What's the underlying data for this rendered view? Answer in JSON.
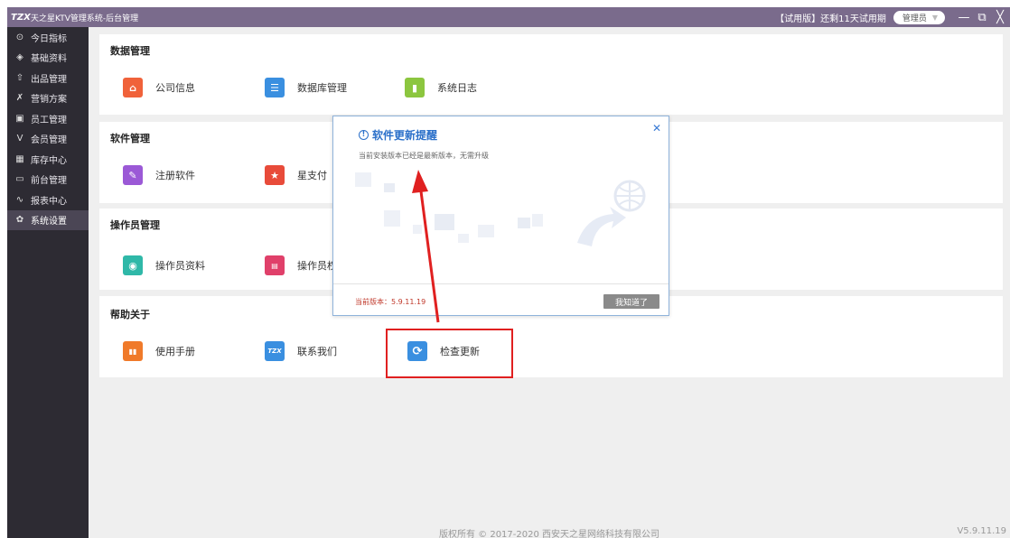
{
  "window": {
    "logo_text": "TZX",
    "title": "天之星KTV管理系统-后台管理",
    "trial_text": "【试用版】还剩11天试用期",
    "user_label": "管理员",
    "user_caret": "▼",
    "minimize": "—",
    "restore": "⧉",
    "close": "╳"
  },
  "sidebar": {
    "items": [
      {
        "label": "今日指标",
        "icon": "target-icon",
        "glyph": "⊙"
      },
      {
        "label": "基础资料",
        "icon": "layers-icon",
        "glyph": "◈"
      },
      {
        "label": "出品管理",
        "icon": "upload-icon",
        "glyph": "⇧"
      },
      {
        "label": "营销方案",
        "icon": "tools-icon",
        "glyph": "✗"
      },
      {
        "label": "员工管理",
        "icon": "id-card-icon",
        "glyph": "▣"
      },
      {
        "label": "会员管理",
        "icon": "vip-icon",
        "glyph": "V"
      },
      {
        "label": "库存中心",
        "icon": "warehouse-icon",
        "glyph": "▦"
      },
      {
        "label": "前台管理",
        "icon": "monitor-icon",
        "glyph": "▭"
      },
      {
        "label": "报表中心",
        "icon": "chart-icon",
        "glyph": "∿"
      },
      {
        "label": "系统设置",
        "icon": "gear-icon",
        "glyph": "✿"
      }
    ],
    "active": "系统设置"
  },
  "sections": {
    "data": {
      "title": "数据管理",
      "items": [
        {
          "label": "公司信息",
          "icon": "home-icon",
          "glyph": "⌂",
          "color": "#f0623a"
        },
        {
          "label": "数据库管理",
          "icon": "database-icon",
          "glyph": "☰",
          "color": "#3a8fe0"
        },
        {
          "label": "系统日志",
          "icon": "log-book-icon",
          "glyph": "▮",
          "color": "#8cc63f"
        }
      ]
    },
    "software": {
      "title": "软件管理",
      "items": [
        {
          "label": "注册软件",
          "icon": "register-icon",
          "glyph": "✎",
          "color": "#9b59d6"
        },
        {
          "label": "星支付",
          "icon": "star-pay-icon",
          "glyph": "★",
          "color": "#e84b3a"
        }
      ]
    },
    "operator": {
      "title": "操作员管理",
      "items": [
        {
          "label": "操作员资料",
          "icon": "operator-icon",
          "glyph": "◉",
          "color": "#2fb8a8"
        },
        {
          "label": "操作员权",
          "icon": "permission-icon",
          "glyph": "▤",
          "color": "#e0406a"
        }
      ]
    },
    "help": {
      "title": "帮助关于",
      "items": [
        {
          "label": "使用手册",
          "icon": "manual-icon",
          "glyph": "▮▮",
          "color": "#f07a2a"
        },
        {
          "label": "联系我们",
          "icon": "contact-logo-icon",
          "glyph": "TZX",
          "color": "#3a8fe0"
        },
        {
          "label": "检查更新",
          "icon": "refresh-icon",
          "glyph": "⟳",
          "color": "#3a8fe0"
        }
      ]
    }
  },
  "footer": {
    "copyright": "版权所有 © 2017-2020 西安天之星网络科技有限公司",
    "version": "V5.9.11.19"
  },
  "dialog": {
    "title": "软件更新提醒",
    "alert_glyph": "!",
    "close": "✕",
    "message": "当前安装版本已经是最新版本，无需升级",
    "current_version": "当前版本：5.9.11.19",
    "ok_label": "我知道了"
  },
  "colors": {
    "titlebar": "#7a6b8c",
    "sidebar": "#2d2b33",
    "sidebar_active": "#4b4655",
    "dialog_title": "#2a6fc9",
    "highlight": "#e02020"
  }
}
